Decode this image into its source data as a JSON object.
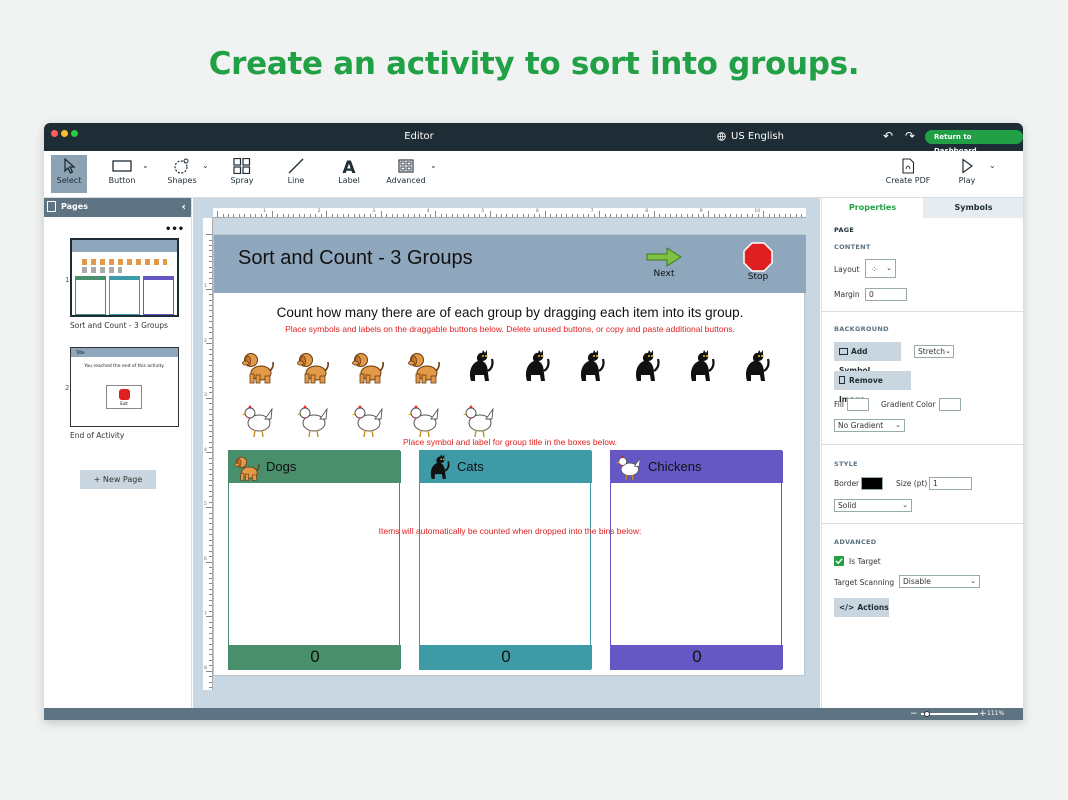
{
  "headline": "Create an activity to sort into groups.",
  "window": {
    "title": "Editor",
    "language": "US English",
    "return_button": "Return to Dashboard"
  },
  "toolbar": {
    "select": "Select",
    "button": "Button",
    "shapes": "Shapes",
    "spray": "Spray",
    "line": "Line",
    "label": "Label",
    "advanced": "Advanced",
    "create_pdf": "Create PDF",
    "play": "Play"
  },
  "sidebar": {
    "title": "Pages",
    "pages": [
      {
        "number": "1",
        "label": "Sort and Count - 3 Groups"
      },
      {
        "number": "2",
        "label": "End of Activity"
      }
    ],
    "thumb2_title": "Title",
    "thumb2_text": "You reached the end of this activity.",
    "thumb2_exit": "Exit",
    "new_page": "+ New Page"
  },
  "ruler": {
    "h": [
      "1",
      "2",
      "3",
      "4",
      "5",
      "6",
      "7",
      "8",
      "9",
      "10"
    ],
    "v": [
      "1",
      "2",
      "3",
      "4",
      "5",
      "6",
      "7",
      "8"
    ]
  },
  "canvas": {
    "title": "Sort and Count - 3 Groups",
    "next": "Next",
    "stop": "Stop",
    "instruction": "Count how many there are of each group by dragging each item into its group.",
    "hint1": "Place symbols and labels on the draggable buttons below.  Delete unused buttons, or copy and paste additional buttons.",
    "hint2": "Place symbol and label for group title in the boxes below.",
    "hint3": "Items will automatically be counted when dropped into the bins below:",
    "items": [
      "dog",
      "dog",
      "dog",
      "dog",
      "cat",
      "cat",
      "cat",
      "cat",
      "cat",
      "cat",
      "chicken",
      "chicken",
      "chicken",
      "chicken",
      "chicken"
    ],
    "bins": [
      {
        "title": "Dogs",
        "count": "0",
        "color": "#4a8f6c"
      },
      {
        "title": "Cats",
        "count": "0",
        "color": "#3f9aa8"
      },
      {
        "title": "Chickens",
        "count": "0",
        "color": "#6658c4"
      }
    ]
  },
  "properties": {
    "tab_properties": "Properties",
    "tab_symbols": "Symbols",
    "page": "PAGE",
    "content": "CONTENT",
    "layout": "Layout",
    "margin": "Margin",
    "margin_value": "0",
    "background": "BACKGROUND",
    "add_symbol": "Add Symbol",
    "stretch": "Stretch",
    "remove_image": "Remove Image",
    "fill": "Fill",
    "gradient_color": "Gradient Color",
    "no_gradient": "No Gradient",
    "style": "STYLE",
    "border": "Border",
    "size": "Size (pt)",
    "size_value": "1",
    "solid": "Solid",
    "advanced": "ADVANCED",
    "is_target": "Is Target",
    "target_scanning": "Target Scanning",
    "disable": "Disable",
    "actions": "Actions"
  },
  "status": {
    "zoom": "111%"
  },
  "colors": {
    "brand_green": "#22a046",
    "titlebar": "#1e2c35",
    "banner": "#8fa7bc"
  }
}
